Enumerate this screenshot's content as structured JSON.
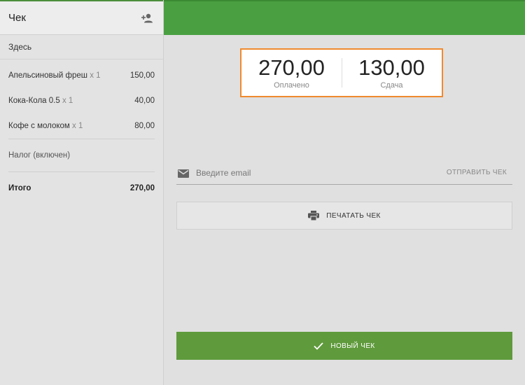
{
  "sidebar": {
    "title": "Чек",
    "add_customer_icon": "person-add-icon",
    "dining_option": "Здесь",
    "items": [
      {
        "name": "Апельсиновый фреш",
        "qty": "x 1",
        "price": "150,00"
      },
      {
        "name": "Кока-Кола 0.5",
        "qty": "x 1",
        "price": "40,00"
      },
      {
        "name": "Кофе с молоком",
        "qty": "x 1",
        "price": "80,00"
      }
    ],
    "tax_label": "Налог (включен)",
    "total_label": "Итого",
    "total_value": "270,00"
  },
  "summary": {
    "paid_value": "270,00",
    "paid_label": "Оплачено",
    "change_value": "130,00",
    "change_label": "Сдача"
  },
  "email": {
    "icon": "mail-icon",
    "placeholder": "Введите email",
    "value": "",
    "send_label": "ОТПРАВИТЬ ЧЕК"
  },
  "print": {
    "icon": "printer-icon",
    "label": "ПЕЧАТАТЬ ЧЕК"
  },
  "new_receipt": {
    "icon": "check-icon",
    "label": "НОВЫЙ ЧЕК"
  },
  "colors": {
    "accent_green": "#4aa041",
    "button_green": "#5f9a3c",
    "highlight_orange": "#ef8a2e"
  }
}
